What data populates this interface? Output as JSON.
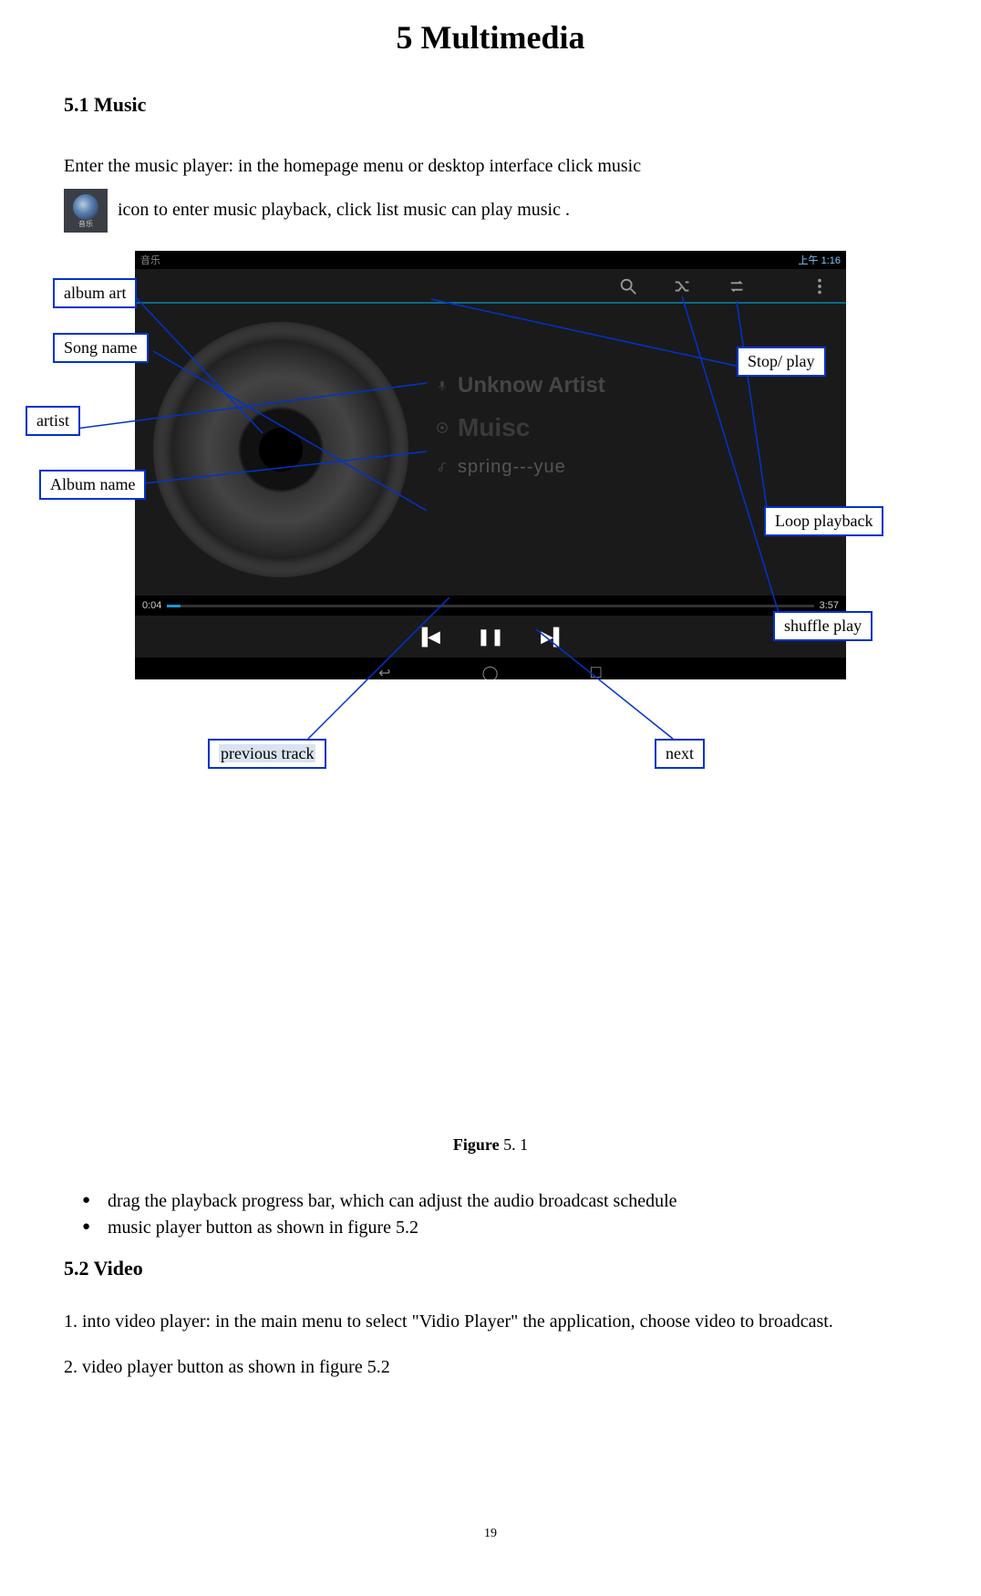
{
  "chapter_title": "5 Multimedia",
  "section_5_1_title": "5.1 Music",
  "intro_part1": "Enter the music player: in the homepage menu or desktop interface click music ",
  "intro_part2": " icon to enter music playback, click list music can play music .",
  "music_icon_label": "音乐",
  "screenshot": {
    "status_app": "音乐",
    "status_time": "上午 1:16",
    "artist_text": "Unknow Artist",
    "album_text": "Muisc",
    "song_text": "spring---yue",
    "time_current": "0:04",
    "time_total": "3:57"
  },
  "callouts": {
    "album_art": "album art",
    "song_name": "Song name",
    "artist": "artist",
    "album_name": "Album name",
    "stop_play": "Stop/ play",
    "loop_playback": "Loop playback",
    "shuffle_play": "shuffle play",
    "previous_track": "previous track",
    "next": "next"
  },
  "figure_caption_label": "Figure",
  "figure_caption_num": "5. 1",
  "bullets": [
    "drag the playback progress bar, which can adjust the audio broadcast schedule",
    "music player button as shown in figure 5.2"
  ],
  "section_5_2_title": "5.2    Video",
  "video_p1": "1. into video player: in the main menu to select \"Vidio Player\" the application, choose video to broadcast.",
  "video_p2": "2. video player button as shown in figure 5.2",
  "page_number": "19"
}
